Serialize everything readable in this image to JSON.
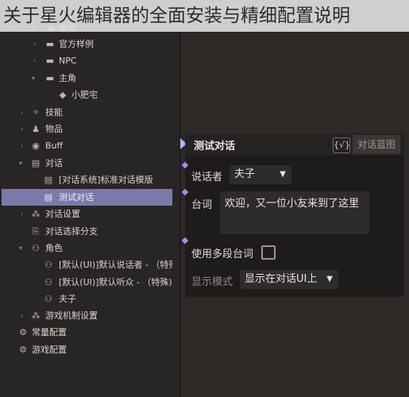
{
  "banner": {
    "title": "关于星火编辑器的全面安装与精细配置说明"
  },
  "sidebar": {
    "items": [
      {
        "label": "单位",
        "icon": "folder-icon"
      },
      {
        "label": "官方样例",
        "icon": "folder-icon"
      },
      {
        "label": "NPC",
        "icon": "folder-icon"
      },
      {
        "label": "主角",
        "icon": "folder-icon"
      },
      {
        "label": "小肥宅",
        "icon": "cube-icon"
      },
      {
        "label": "技能",
        "icon": "skill-icon"
      },
      {
        "label": "物品",
        "icon": "item-icon"
      },
      {
        "label": "Buff",
        "icon": "buff-icon"
      },
      {
        "label": "对话",
        "icon": "dialog-icon"
      },
      {
        "label": "[对话系统]标准对话模版",
        "icon": "dialog-icon"
      },
      {
        "label": "测试对话",
        "icon": "dialog-icon"
      },
      {
        "label": "对话设置",
        "icon": "settings-icon"
      },
      {
        "label": "对话选择分支",
        "icon": "branch-icon"
      },
      {
        "label": "角色",
        "icon": "users-icon"
      },
      {
        "label": "[默认(UI)]默认说话者 - （特殊...",
        "icon": "users-icon"
      },
      {
        "label": "[默认(UI)]默认听众 - （特殊)",
        "icon": "users-icon"
      },
      {
        "label": "夫子",
        "icon": "users-icon"
      },
      {
        "label": "游戏机制设置",
        "icon": "settings-icon"
      },
      {
        "label": "常量配置",
        "icon": "gear-icon"
      },
      {
        "label": "游戏配置",
        "icon": "gear-icon"
      }
    ]
  },
  "node": {
    "title": "测试对话",
    "badge": "{√}",
    "blueprint_button": "对话蓝图",
    "speaker_label": "说话者",
    "speaker_value": "夫子",
    "line_label": "台词",
    "line_value": "欢迎，又一位小友来到了这里",
    "multi_line_label": "使用多段台词",
    "display_mode_label": "显示模式",
    "display_mode_value": "显示在对话UI上"
  },
  "colors": {
    "selection": "#7a7aa8",
    "pin": "#a18cff"
  }
}
